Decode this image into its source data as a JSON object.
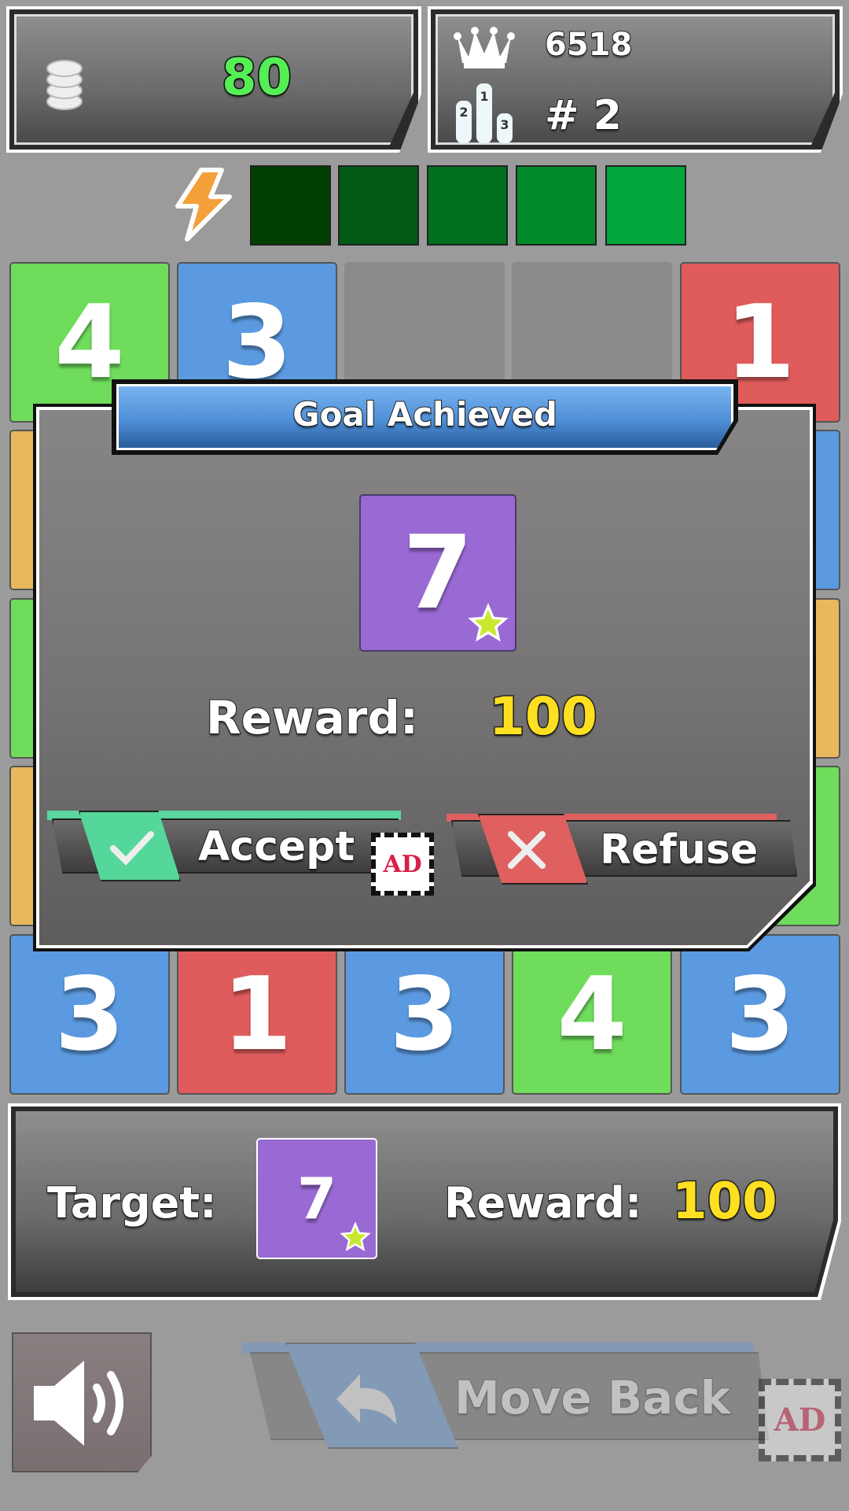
{
  "coins": {
    "icon": "coin-stack-icon",
    "value": "80"
  },
  "stats": {
    "best_score": "6518",
    "rank": "# 2",
    "crown_icon": "crown-icon",
    "podium_icon": "podium-icon"
  },
  "energy": {
    "icon": "lightning-icon",
    "segments": 5,
    "filled": 5,
    "colors": [
      "#003f00",
      "#005a14",
      "#00701e",
      "#008a2a",
      "#00a63c"
    ]
  },
  "grid": {
    "colors": {
      "green": "#6fdc5c",
      "blue": "#5b9ae0",
      "red": "#e05c5c",
      "orange": "#e8b85c",
      "purple": "#9a6ad4",
      "empty": "#8c8b8c"
    },
    "top_row": [
      {
        "v": "4",
        "c": "green"
      },
      {
        "v": "3",
        "c": "blue"
      },
      {
        "v": "",
        "c": "empty"
      },
      {
        "v": "",
        "c": "empty"
      },
      {
        "v": "1",
        "c": "red"
      }
    ],
    "bottom_row": [
      {
        "v": "3",
        "c": "blue"
      },
      {
        "v": "1",
        "c": "red"
      },
      {
        "v": "3",
        "c": "blue"
      },
      {
        "v": "4",
        "c": "green"
      },
      {
        "v": "3",
        "c": "blue"
      }
    ],
    "left_edge": [
      "orange",
      "green",
      "orange"
    ],
    "right_edge": [
      "blue",
      "orange",
      "green"
    ]
  },
  "dialog": {
    "title": "Goal Achieved",
    "tile_value": "7",
    "reward_label": "Reward:",
    "reward_value": "100",
    "accept_label": "Accept",
    "ad_label": "AD",
    "refuse_label": "Refuse"
  },
  "target_panel": {
    "target_label": "Target:",
    "tile_value": "7",
    "reward_label": "Reward:",
    "reward_value": "100"
  },
  "controls": {
    "sound_icon": "speaker-icon",
    "move_back_label": "Move Back",
    "ad_label": "AD"
  }
}
